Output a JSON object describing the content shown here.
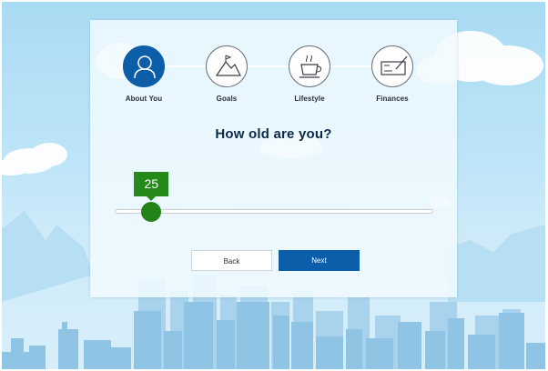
{
  "steps": [
    {
      "label": "About You",
      "icon": "person-icon",
      "active": true
    },
    {
      "label": "Goals",
      "icon": "mountain-icon",
      "active": false
    },
    {
      "label": "Lifestyle",
      "icon": "coffee-cup-icon",
      "active": false
    },
    {
      "label": "Finances",
      "icon": "check-icon",
      "active": false
    }
  ],
  "question": "How old are you?",
  "slider": {
    "value": "25",
    "fraction": 0.115
  },
  "buttons": {
    "back": "Back",
    "next": "Next"
  },
  "colors": {
    "accent": "#0d5ea8",
    "slider": "#228418",
    "sky": "#a9dbf4"
  }
}
